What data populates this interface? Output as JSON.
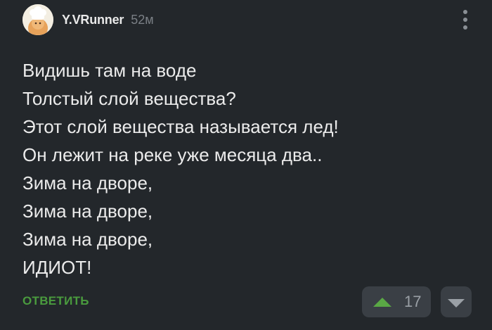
{
  "comment": {
    "author": "Y.VRunner",
    "time": "52м",
    "avatar_icon": "baker-avatar-icon",
    "lines": [
      "Видишь там на воде",
      "Толстый слой вещества?",
      "Этот слой вещества называется лед!",
      "Он лежит на реке уже месяца два..",
      "Зима на дворе,",
      "Зима на дворе,",
      "Зима на дворе,",
      "ИДИОТ!"
    ],
    "reply_label": "ОТВЕТИТЬ",
    "rating": "17"
  },
  "colors": {
    "background": "#23272b",
    "accent_green": "#4a9b3e",
    "upvote": "#5aa845",
    "vote_box": "#3a3f45"
  }
}
